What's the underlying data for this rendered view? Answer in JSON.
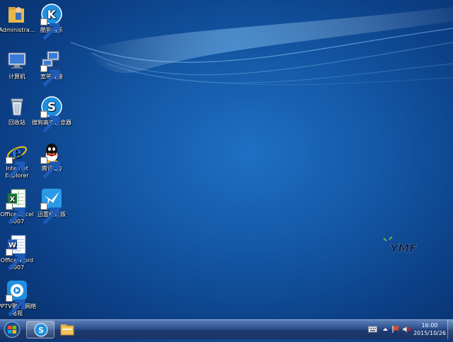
{
  "desktop": {
    "icons": [
      {
        "label": "Administra...",
        "icon": "user-folder-icon"
      },
      {
        "label": "酷狗音乐",
        "icon": "kugou-music-icon"
      },
      {
        "label": "计算机",
        "icon": "computer-icon"
      },
      {
        "label": "宽带连接",
        "icon": "network-connection-icon"
      },
      {
        "label": "回收站",
        "icon": "recycle-bin-icon"
      },
      {
        "label": "搜狗高速浏览器",
        "icon": "sogou-browser-icon"
      },
      {
        "label": "Internet Explorer",
        "icon": "internet-explorer-icon"
      },
      {
        "label": "腾讯QQ",
        "icon": "qq-icon"
      },
      {
        "label": "Office Excel 2007",
        "icon": "excel-icon"
      },
      {
        "label": "迅雷极速版",
        "icon": "xunlei-icon"
      },
      {
        "label": "Office Word 2007",
        "icon": "word-icon"
      },
      {
        "label": "PPTV聚力 网络电视",
        "icon": "pptv-icon"
      }
    ],
    "brand_logo": "YMF"
  },
  "taskbar": {
    "pinned": [
      {
        "icon": "sogou-browser-icon",
        "active": true
      },
      {
        "icon": "file-explorer-icon",
        "active": false
      }
    ],
    "tray": {
      "icons": [
        "keyboard-icon",
        "flag-icon",
        "network-icon",
        "volume-muted-icon"
      ],
      "time": "16:00",
      "date": "2015/10/26"
    }
  },
  "colors": {
    "desktop_blue": "#145aa8",
    "taskbar": "#2c4f8d"
  }
}
